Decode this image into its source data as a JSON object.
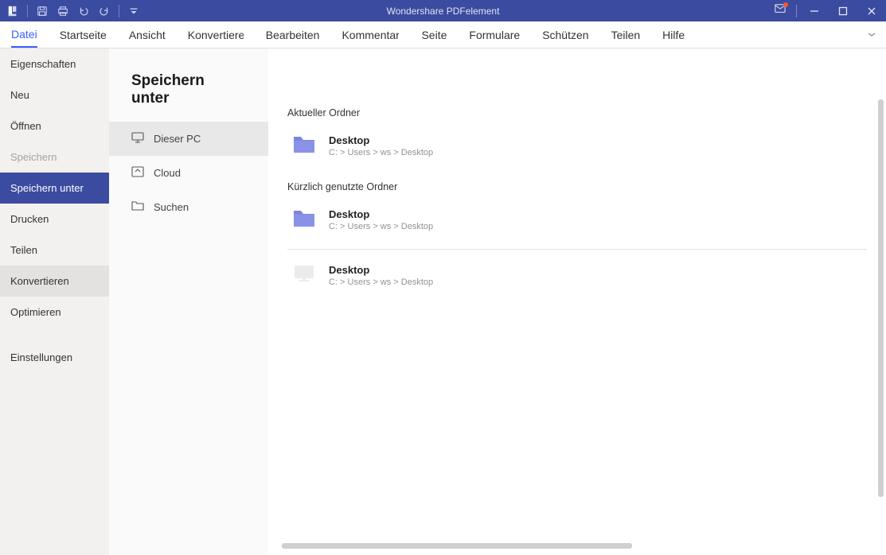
{
  "titlebar": {
    "title": "Wondershare PDFelement"
  },
  "ribbon": {
    "tabs": [
      {
        "label": "Datei",
        "active": true
      },
      {
        "label": "Startseite"
      },
      {
        "label": "Ansicht"
      },
      {
        "label": "Konvertieren"
      },
      {
        "label": "Bearbeiten"
      },
      {
        "label": "Kommentar"
      },
      {
        "label": "Seite"
      },
      {
        "label": "Formulare"
      },
      {
        "label": "Schützen"
      },
      {
        "label": "Teilen"
      },
      {
        "label": "Hilfe"
      }
    ]
  },
  "filemenu": {
    "items": [
      {
        "label": "Eigenschaften"
      },
      {
        "label": "Neu"
      },
      {
        "label": "Öffnen"
      },
      {
        "label": "Speichern",
        "disabled": true
      },
      {
        "label": "Speichern unter",
        "active": true
      },
      {
        "label": "Drucken"
      },
      {
        "label": "Teilen"
      },
      {
        "label": "Konvertieren",
        "hover": true
      },
      {
        "label": "Optimieren"
      }
    ],
    "settings_label": "Einstellungen"
  },
  "loc": {
    "heading": "Speichern unter",
    "items": [
      {
        "icon": "pc",
        "label": "Dieser PC",
        "active": true
      },
      {
        "icon": "cloud",
        "label": "Cloud"
      },
      {
        "icon": "search",
        "label": "Suchen"
      }
    ]
  },
  "content": {
    "current_label": "Aktueller Ordner",
    "recent_label": "Kürzlich genutzte Ordner",
    "current_folder": {
      "name": "Desktop",
      "path": "C: > Users > ws > Desktop"
    },
    "recent": [
      {
        "icon": "folder",
        "name": "Desktop",
        "path": "C: > Users > ws > Desktop"
      },
      {
        "icon": "pc",
        "name": "Desktop",
        "path": "C: > Users > ws > Desktop"
      }
    ]
  }
}
